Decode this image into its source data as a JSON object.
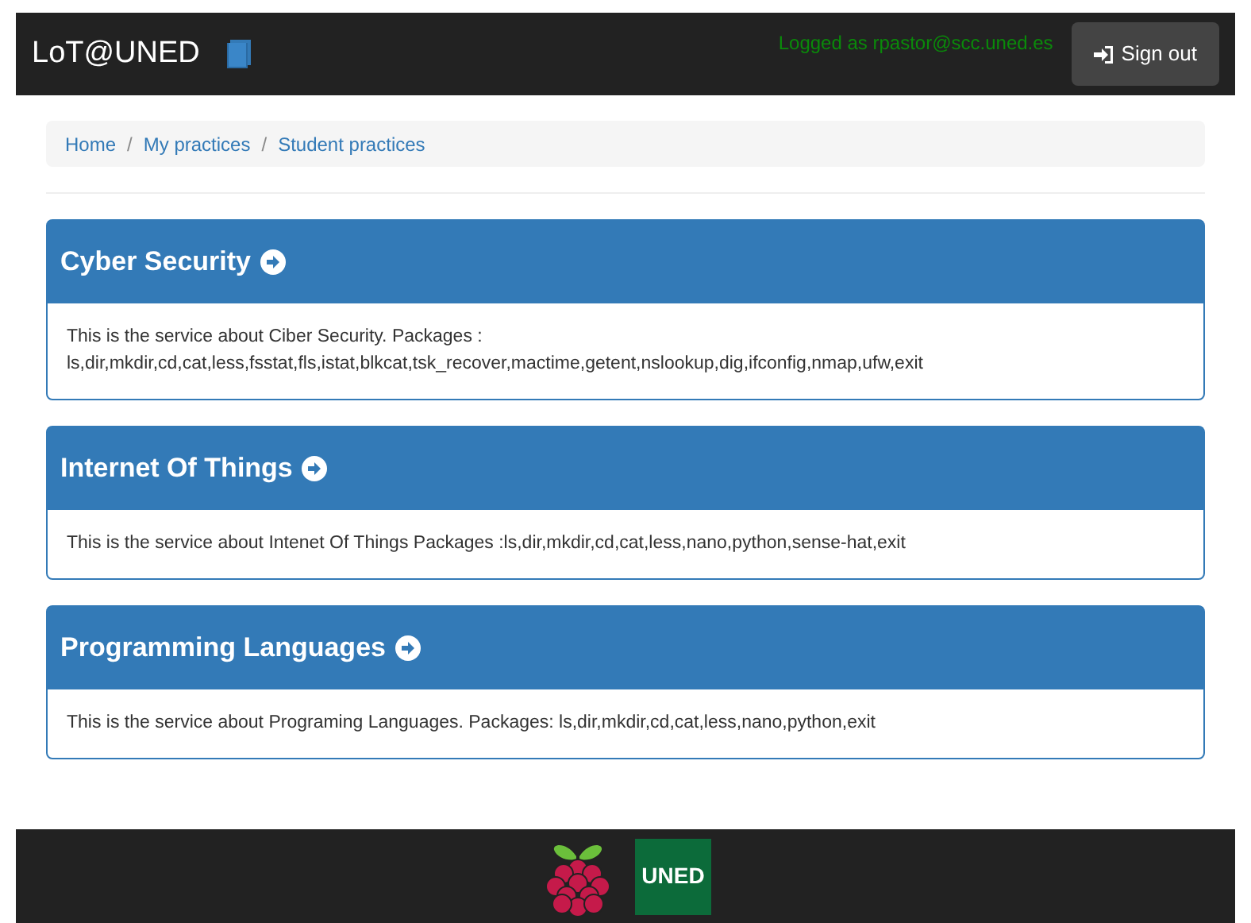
{
  "navbar": {
    "brand": "LoT@UNED",
    "user": "Logged as rpastor@scc.uned.es",
    "sign_out": "Sign out"
  },
  "breadcrumb": [
    {
      "label": "Home",
      "selected": false
    },
    {
      "separator": "/",
      "label": "My practices",
      "selected": false
    },
    {
      "separator": "/",
      "label": "Student practices",
      "selected": false
    }
  ],
  "services": [
    {
      "title": "Cyber Security",
      "description": "This is the service about Ciber Security. Packages : ls,dir,mkdir,cd,cat,less,fsstat,fls,istat,blkcat,tsk_recover,mactime,getent,nslookup,dig,ifconfig,nmap,ufw,exit"
    },
    {
      "title": "Internet Of Things",
      "description": "This is the service about Intenet Of Things Packages :ls,dir,mkdir,cd,cat,less,nano,python,sense-hat,exit"
    },
    {
      "title": "Programming Languages",
      "description": "This is the service about Programing Languages. Packages: ls,dir,mkdir,cd,cat,less,nano,python,exit"
    }
  ],
  "footer": {
    "logo_text": "UNED"
  }
}
